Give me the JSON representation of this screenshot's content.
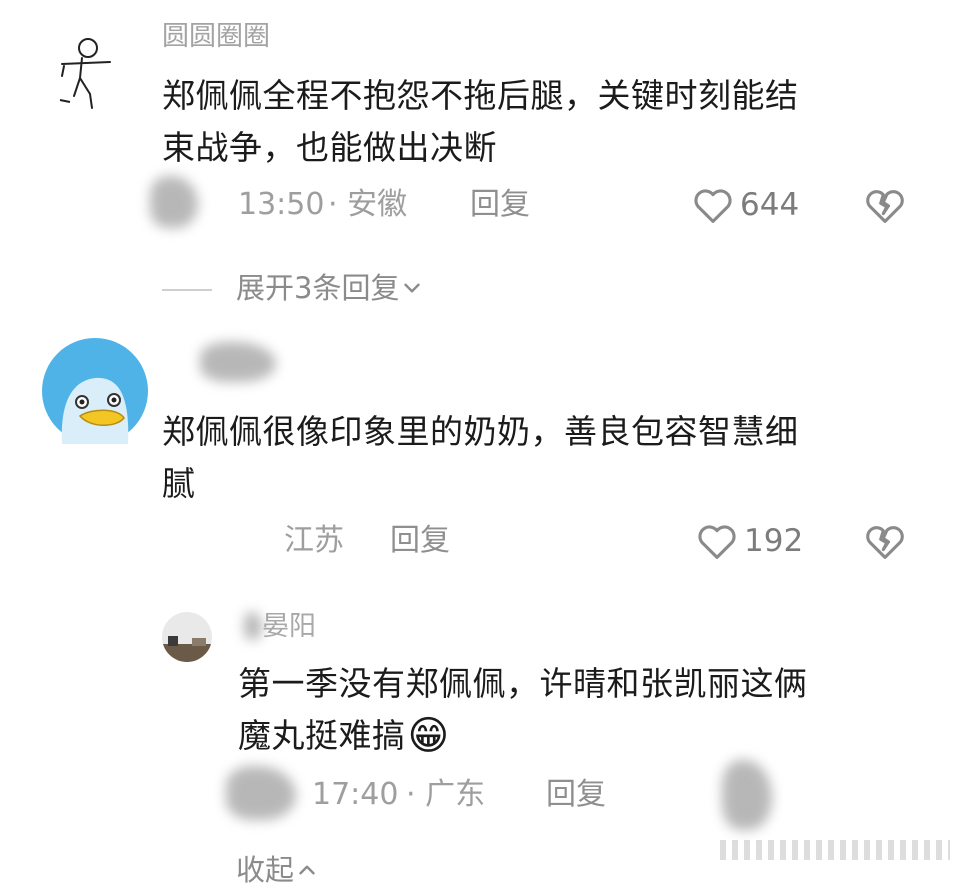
{
  "comments": [
    {
      "username": "圆圆圈圈",
      "text_line1": "郑佩佩全程不抱怨不拖后腿，关键时刻能结",
      "text_line2": "束战争，也能做出决断",
      "time": "13:50",
      "location": "· 安徽",
      "reply_label": "回复",
      "likes": "644",
      "expand_label": "展开3条回复"
    },
    {
      "text_line1": "郑佩佩很像印象里的奶奶，善良包容智慧细",
      "text_line2": "腻",
      "location": "江苏",
      "reply_label": "回复",
      "likes": "192"
    }
  ],
  "reply": {
    "username": "晏阳",
    "text_line1": "第一季没有郑佩佩，许晴和张凯丽这俩",
    "text_line2": "魔丸挺难搞",
    "emoji": "😁",
    "time": "17:40",
    "location": "· 广东",
    "reply_label": "回复"
  },
  "collapse_label": "收起",
  "colors": {
    "text": "#1b1b1b",
    "meta": "#9e9e9e",
    "avatar_bg": "#4fb3e8",
    "duck_beak": "#f3c623"
  },
  "icons": [
    "heart-icon",
    "broken-heart-icon",
    "chevron-down-icon",
    "chevron-up-icon"
  ]
}
